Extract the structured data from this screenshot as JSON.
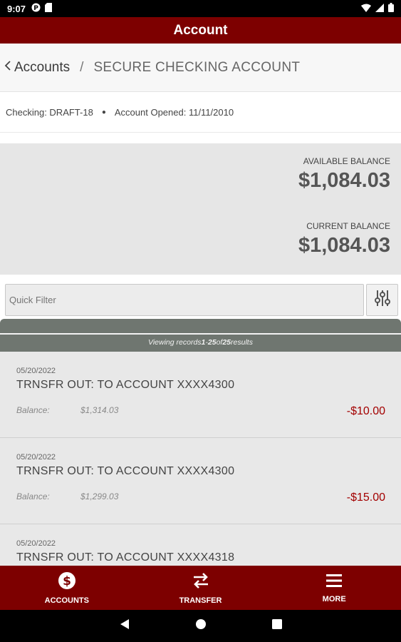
{
  "status_bar": {
    "time": "9:07"
  },
  "app_bar": {
    "title": "Account"
  },
  "breadcrumb": {
    "back_label": "Accounts",
    "separator": "/",
    "current": "SECURE CHECKING ACCOUNT"
  },
  "account_info": {
    "type_label": "Checking: DRAFT-18",
    "opened_label": "Account Opened: 11/11/2010"
  },
  "balances": {
    "available_label": "AVAILABLE BALANCE",
    "available_value": "$1,084.03",
    "current_label": "CURRENT BALANCE",
    "current_value": "$1,084.03"
  },
  "filter": {
    "placeholder": "Quick Filter"
  },
  "records": {
    "prefix": "Viewing records ",
    "from": "1",
    "dash": " - ",
    "to": "25",
    "of": " of ",
    "total": "25",
    "suffix": " results"
  },
  "transactions": [
    {
      "date": "05/20/2022",
      "description": "TRNSFR OUT: TO ACCOUNT XXXX4300",
      "balance_label": "Balance:",
      "balance": "$1,314.03",
      "amount": "-$10.00"
    },
    {
      "date": "05/20/2022",
      "description": "TRNSFR OUT: TO ACCOUNT XXXX4300",
      "balance_label": "Balance:",
      "balance": "$1,299.03",
      "amount": "-$15.00"
    },
    {
      "date": "05/20/2022",
      "description": "TRNSFR OUT: TO ACCOUNT XXXX4318",
      "balance_label": "",
      "balance": "",
      "amount": ""
    }
  ],
  "bottom_nav": {
    "accounts": "ACCOUNTS",
    "transfer": "TRANSFER",
    "more": "MORE"
  },
  "colors": {
    "brand": "#7d0000",
    "negative_amount": "#a30000",
    "records_bar": "#6f7670",
    "balance_panel": "#e6e6e6"
  },
  "icons": {
    "back": "chevron-left-icon",
    "filter": "sliders-icon",
    "accounts": "dollar-circle-icon",
    "transfer": "swap-arrows-icon",
    "more": "hamburger-menu-icon"
  }
}
